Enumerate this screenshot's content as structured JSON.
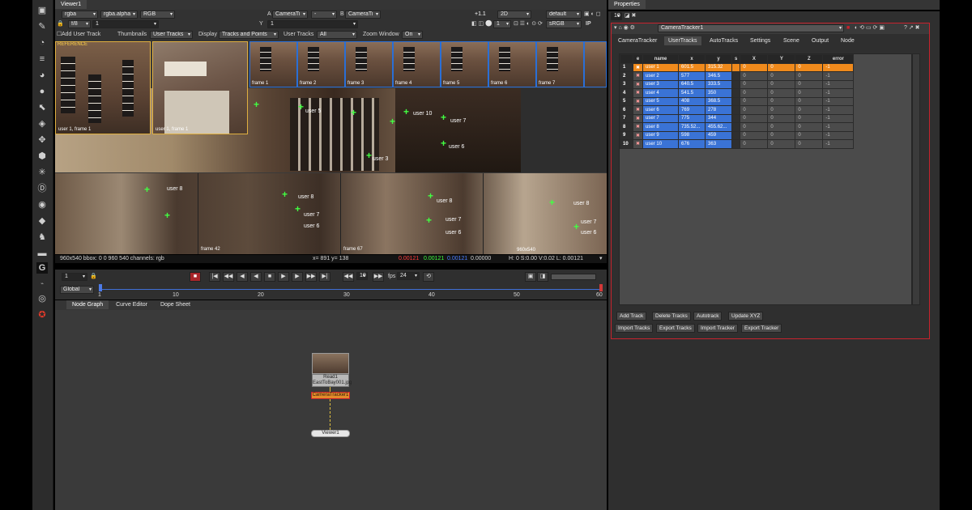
{
  "viewer_tab": "Viewer1",
  "properties_tab": "Properties",
  "toolbar1": {
    "channel": "rgba",
    "alpha": "rgba.alpha",
    "rgb": "RGB",
    "a_label": "A",
    "a_input": "CameraTi",
    "b_sep": "-",
    "b_label": "B",
    "b_input": "CameraTi",
    "gain": "+1.1",
    "mode": "2D",
    "lut": "default"
  },
  "toolbar2": {
    "fstop": "f/8",
    "frame": "1",
    "y_label": "Y",
    "y_value": "1",
    "lut2": "sRGB",
    "ip": "IP"
  },
  "toolbar3": {
    "add_user_track": "Add User Track",
    "thumbnails_label": "Thumbnails",
    "thumbnails_value": "User Tracks",
    "display_label": "Display",
    "display_value": "Tracks and Points",
    "user_tracks_label": "User Tracks",
    "user_tracks_value": "All",
    "zoom_label": "Zoom Window",
    "zoom_value": "On"
  },
  "viewer": {
    "reference_label": "REFERENCE",
    "ref_caption": "user 1, frame 1",
    "zoom_caption": "user 1, frame 1",
    "strip_frames": [
      "frame 1",
      "frame 2",
      "frame 3",
      "frame 4",
      "frame 5",
      "frame 6",
      "frame 7"
    ],
    "main_users": [
      "user 5",
      "user 10",
      "user 7",
      "user 6",
      "user 3"
    ],
    "bottom_frames": [
      "frame 42",
      "frame 67"
    ],
    "bottom_users": [
      "user 8",
      "user 3",
      "user 7",
      "user 6",
      "user 9",
      "user 10"
    ],
    "res_label": "960x540"
  },
  "infobar": {
    "left": "960x540 bbox: 0 0 960 540 channels: rgb",
    "coords": "x= 891 y= 138",
    "r": "0.00121",
    "g": "0.00121",
    "b": "0.00121",
    "a": "0.00000",
    "hsv": "H: 0 S:0.00 V:0.02 L: 0.00121"
  },
  "transport": {
    "frame": "1",
    "step": "10",
    "fps_label": "fps",
    "fps": "24"
  },
  "timeline": {
    "scope": "Global",
    "ticks": [
      "1",
      "10",
      "20",
      "30",
      "40",
      "50",
      "60"
    ]
  },
  "lower_tabs": [
    "Node Graph",
    "Curve Editor",
    "Dope Sheet"
  ],
  "nodes": {
    "read_label": "Read1",
    "read_file": "EastToBay001.jpg",
    "tracker_label": "CameraTracker1",
    "viewer_label": "Viewer1"
  },
  "props": {
    "spin_value": "10",
    "node_name": "CameraTracker1",
    "tabs": [
      "CameraTracker",
      "UserTracks",
      "AutoTracks",
      "Settings",
      "Scene",
      "Output",
      "Node"
    ],
    "columns": [
      "e",
      "name",
      "x",
      "y",
      "s",
      "X",
      "Y",
      "Z",
      "error"
    ],
    "rows": [
      {
        "n": "1",
        "name": "user 1",
        "x": "601.5",
        "y": "315.32",
        "X": "0",
        "Y": "0",
        "Z": "0",
        "err": "-1"
      },
      {
        "n": "2",
        "name": "user 2",
        "x": "577",
        "y": "346.5",
        "X": "0",
        "Y": "0",
        "Z": "0",
        "err": "-1"
      },
      {
        "n": "3",
        "name": "user 3",
        "x": "640.5",
        "y": "333.5",
        "X": "0",
        "Y": "0",
        "Z": "0",
        "err": "-1"
      },
      {
        "n": "4",
        "name": "user 4",
        "x": "541.5",
        "y": "350",
        "X": "0",
        "Y": "0",
        "Z": "0",
        "err": "-1"
      },
      {
        "n": "5",
        "name": "user 5",
        "x": "408",
        "y": "368.5",
        "X": "0",
        "Y": "0",
        "Z": "0",
        "err": "-1"
      },
      {
        "n": "6",
        "name": "user 6",
        "x": "769",
        "y": "278",
        "X": "0",
        "Y": "0",
        "Z": "0",
        "err": "-1"
      },
      {
        "n": "7",
        "name": "user 7",
        "x": "775",
        "y": "344",
        "X": "0",
        "Y": "0",
        "Z": "0",
        "err": "-1"
      },
      {
        "n": "8",
        "name": "user 8",
        "x": "735.52...",
        "y": "455.62...",
        "X": "0",
        "Y": "0",
        "Z": "0",
        "err": "-1"
      },
      {
        "n": "9",
        "name": "user 9",
        "x": "598",
        "y": "459",
        "X": "0",
        "Y": "0",
        "Z": "0",
        "err": "-1"
      },
      {
        "n": "10",
        "name": "user 10",
        "x": "676",
        "y": "363",
        "X": "0",
        "Y": "0",
        "Z": "0",
        "err": "-1"
      }
    ],
    "buttons_row1": [
      "Add Track",
      "Delete Tracks",
      "Autotrack",
      "Update XYZ"
    ],
    "buttons_row2": [
      "Import Tracks",
      "Export Tracks",
      "Import Tracker",
      "Export Tracker"
    ]
  },
  "colors": {
    "selected_row": "#f08a1c",
    "track_cell": "#3a73d6",
    "highlight": "#c7232d",
    "tracker_marker": "#42ff42"
  }
}
